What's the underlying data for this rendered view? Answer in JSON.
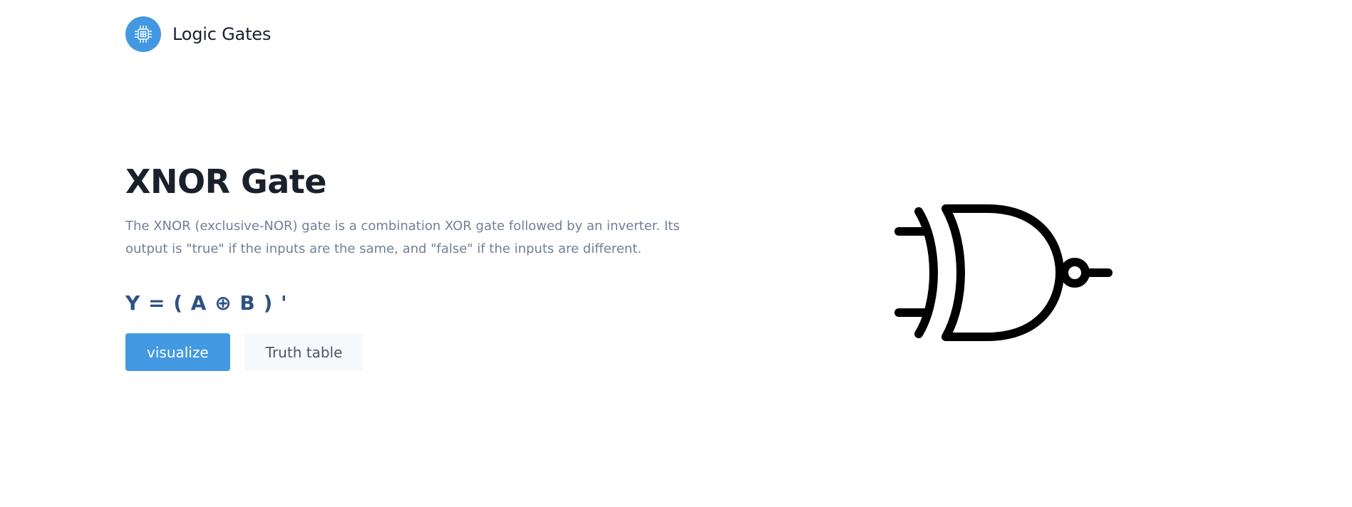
{
  "header": {
    "brand_name": "Logic Gates",
    "logo_icon": "cpu-chip-icon"
  },
  "hero": {
    "title": "XNOR Gate",
    "description": "The XNOR (exclusive-NOR) gate is a combination XOR gate followed by an inverter. Its output is \"true\" if the inputs are the same, and \"false\" if the inputs are different.",
    "formula": "Y = ( A ⊕ B ) '",
    "buttons": {
      "visualize": "visualize",
      "truth_table": "Truth table"
    }
  },
  "gate_symbol": "xnor-gate-icon",
  "colors": {
    "accent": "#4299e1",
    "title": "#1a202c",
    "description": "#718096",
    "formula": "#2c5282",
    "secondary_button_bg": "#f7fafc"
  }
}
